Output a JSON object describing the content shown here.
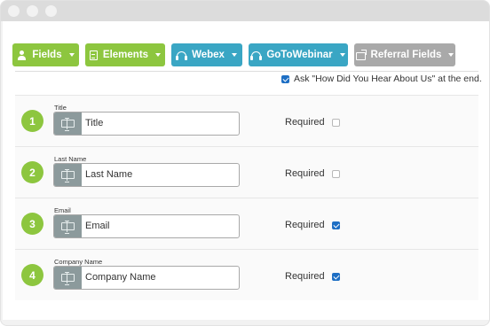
{
  "toolbar": {
    "buttons": [
      {
        "label": "Fields",
        "icon": "user-icon",
        "color": "#8dc63f"
      },
      {
        "label": "Elements",
        "icon": "document-icon",
        "color": "#8dc63f"
      },
      {
        "label": "Webex",
        "icon": "headset-icon",
        "color": "#3aa6c4"
      },
      {
        "label": "GoToWebinar",
        "icon": "headset-icon",
        "color": "#3aa6c4"
      },
      {
        "label": "Referral Fields",
        "icon": "share-icon",
        "color": "#a9a9a9"
      }
    ]
  },
  "ask_option": {
    "label": "Ask \"How Did You Hear About Us\" at the end.",
    "checked": true
  },
  "required_label": "Required",
  "fields": [
    {
      "number": "1",
      "label": "Title",
      "value": "Title",
      "required": false
    },
    {
      "number": "2",
      "label": "Last Name",
      "value": "Last Name",
      "required": false
    },
    {
      "number": "3",
      "label": "Email",
      "value": "Email",
      "required": true
    },
    {
      "number": "4",
      "label": "Company Name",
      "value": "Company Name",
      "required": true
    }
  ],
  "colors": {
    "accent_green": "#8dc63f",
    "accent_teal": "#3aa6c4",
    "disabled_gray": "#a9a9a9",
    "checkbox_blue": "#1e6fc4"
  }
}
